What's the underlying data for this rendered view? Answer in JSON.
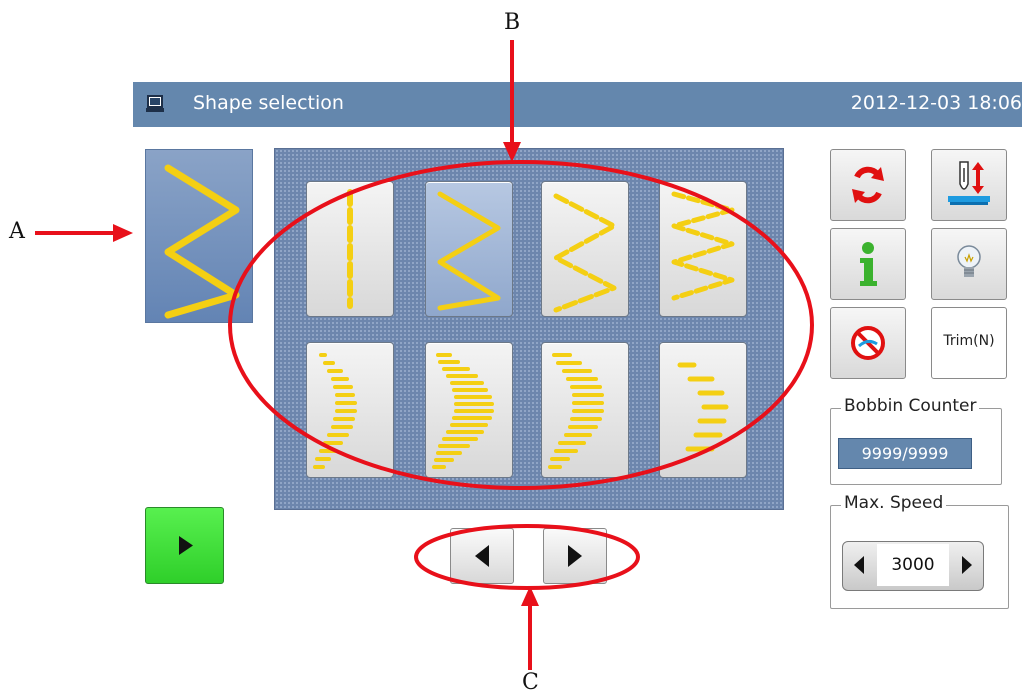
{
  "annotations": {
    "a": "A",
    "b": "B",
    "c": "C",
    "arrow_color": "#e8101a"
  },
  "titlebar": {
    "icon": "monitor-icon",
    "title": "Shape selection",
    "datetime": "2012-12-03  18:06"
  },
  "preview": {
    "shape": "zigzag"
  },
  "shapes": [
    {
      "name": "straight-dashed",
      "selected": false
    },
    {
      "name": "zigzag",
      "selected": true
    },
    {
      "name": "zigzag-dashed",
      "selected": false
    },
    {
      "name": "double-zigzag-dashed",
      "selected": false
    },
    {
      "name": "crescent-small",
      "selected": false
    },
    {
      "name": "crescent-large",
      "selected": false
    },
    {
      "name": "crescent-sparse",
      "selected": false
    },
    {
      "name": "staggered-bars",
      "selected": false
    }
  ],
  "nav": {
    "prev_icon": "triangle-left-icon",
    "next_icon": "triangle-right-icon"
  },
  "tools": {
    "cycle": "cycle-arrows-icon",
    "needle": "needle-up-down-icon",
    "info": "info-icon",
    "bulb": "light-bulb-icon",
    "no_thread": "no-thread-icon",
    "trim_label": "Trim(N)"
  },
  "bobbin": {
    "title": "Bobbin Counter",
    "value": "9999/9999"
  },
  "speed": {
    "title": "Max. Speed",
    "value": "3000"
  },
  "colors": {
    "accent": "#6487ad",
    "stitch": "#f4cf13",
    "start": "#33d62c",
    "annotation": "#e8101a"
  }
}
